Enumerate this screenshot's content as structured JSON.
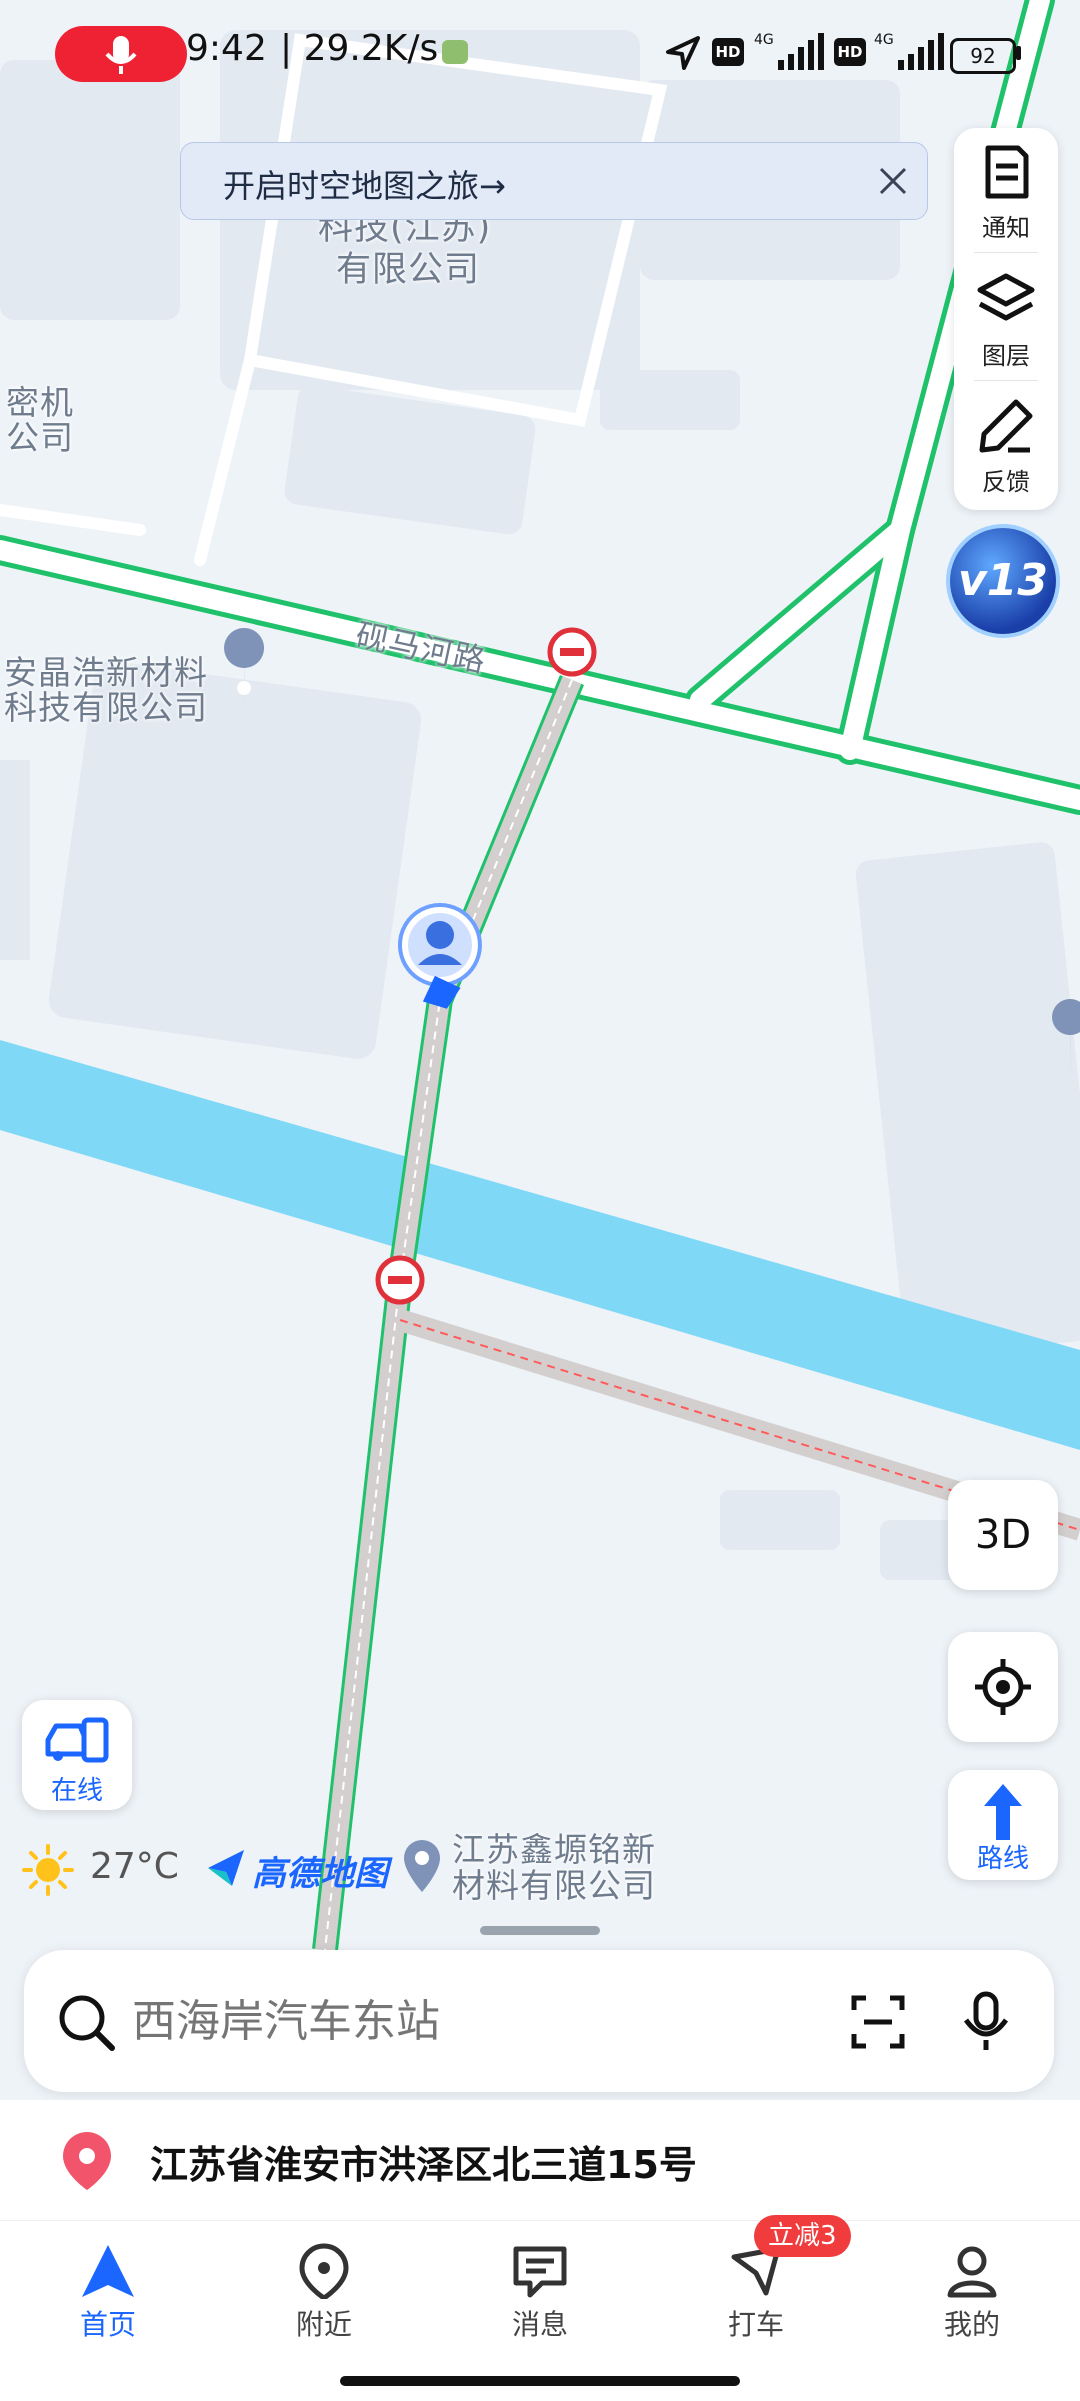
{
  "status_bar": {
    "time": "9:42",
    "net_speed": "| 29.2K/s",
    "battery": "92"
  },
  "banner": {
    "text": "开启时空地图之旅→"
  },
  "map_labels": {
    "company_top_1": "科技(江苏)",
    "company_top_2": "有限公司",
    "company_left_1": "密机",
    "company_left_2": "公司",
    "road": "砚马河路",
    "company_mid_1": "安晶浩新材料",
    "company_mid_2": "科技有限公司",
    "company_bottom_1": "江苏鑫塬铭新",
    "company_bottom_2": "材料有限公司"
  },
  "tools": {
    "notify_label": "通知",
    "layers_label": "图层",
    "feedback_label": "反馈",
    "version_badge": "v13"
  },
  "controls": {
    "three_d": "3D",
    "route_label": "路线",
    "online_label": "在线"
  },
  "weather": {
    "temp": "27°C",
    "brand": "高德地图"
  },
  "search": {
    "placeholder": "西海岸汽车东站"
  },
  "address": {
    "text": "江苏省淮安市洪泽区北三道15号"
  },
  "tabs": [
    {
      "label": "首页"
    },
    {
      "label": "附近"
    },
    {
      "label": "消息"
    },
    {
      "label": "打车",
      "badge": "立减3"
    },
    {
      "label": "我的"
    }
  ],
  "colors": {
    "accent": "#1a66ff",
    "road_green": "#1fc26b",
    "river": "#7fd8f6",
    "badge_red": "#f03c3c"
  }
}
